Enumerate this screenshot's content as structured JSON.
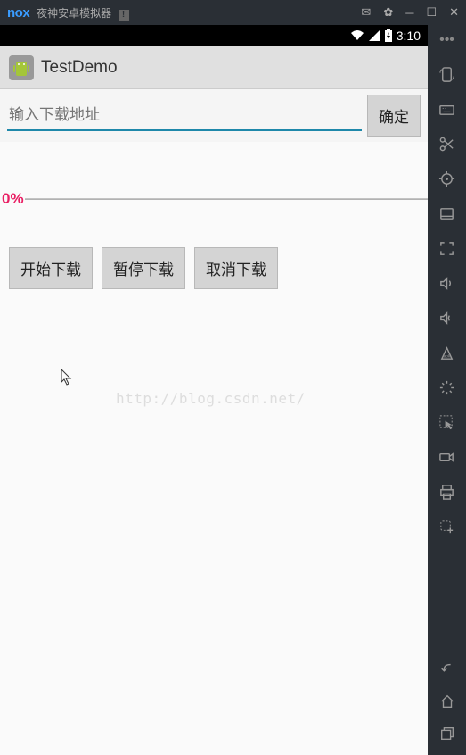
{
  "window": {
    "logo": "nox",
    "title": "夜神安卓模拟器"
  },
  "statusbar": {
    "time": "3:10"
  },
  "app": {
    "title": "TestDemo"
  },
  "input": {
    "placeholder": "输入下载地址",
    "confirm_label": "确定"
  },
  "progress": {
    "label": "0%"
  },
  "buttons": {
    "start": "开始下载",
    "pause": "暂停下载",
    "cancel": "取消下载"
  },
  "watermark": "http://blog.csdn.net/"
}
